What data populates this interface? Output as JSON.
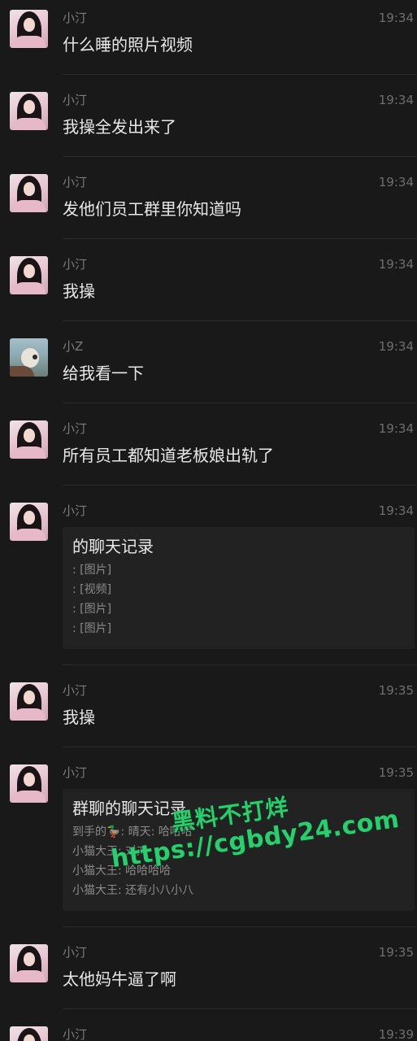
{
  "messages": [
    {
      "sender": "小汀",
      "time": "19:34",
      "text": "什么睡的照片视频",
      "avatar": "girl-avatar"
    },
    {
      "sender": "小汀",
      "time": "19:34",
      "text": "我操全发出来了",
      "avatar": "girl-avatar"
    },
    {
      "sender": "小汀",
      "time": "19:34",
      "text": "发他们员工群里你知道吗",
      "avatar": "girl-avatar"
    },
    {
      "sender": "小汀",
      "time": "19:34",
      "text": "我操",
      "avatar": "girl-avatar"
    },
    {
      "sender": "小Z",
      "time": "19:34",
      "text": "给我看一下",
      "avatar": "seaside-avatar"
    },
    {
      "sender": "小汀",
      "time": "19:34",
      "text": "所有员工都知道老板娘出轨了",
      "avatar": "girl-avatar"
    },
    {
      "sender": "小汀",
      "time": "19:34",
      "avatar": "girl-avatar",
      "card": {
        "title": "的聊天记录",
        "lines": [
          ": [图片]",
          ": [视频]",
          ": [图片]",
          ": [图片]"
        ]
      }
    },
    {
      "sender": "小汀",
      "time": "19:35",
      "text": "我操",
      "avatar": "girl-avatar"
    },
    {
      "sender": "小汀",
      "time": "19:35",
      "avatar": "girl-avatar",
      "card": {
        "title": "群聊的聊天记录",
        "lines": [
          "到手的🦆: 晴天: 哈哈哈",
          "小猫大王: 对对",
          "小猫大王: 哈哈哈哈",
          "小猫大王: 还有小八小八"
        ]
      }
    },
    {
      "sender": "小汀",
      "time": "19:35",
      "text": "太他妈牛逼了啊",
      "avatar": "girl-avatar"
    },
    {
      "sender": "小汀",
      "time": "19:39",
      "text": "",
      "avatar": "girl-avatar"
    }
  ],
  "watermark": {
    "line1": "黑料不打烊",
    "line2": "https://cgbdy24.com"
  },
  "colors": {
    "background": "#191919",
    "text": "#e8e8e8",
    "meta": "#7c7c7c",
    "card": "#222222",
    "watermark": "#2ecc71"
  }
}
